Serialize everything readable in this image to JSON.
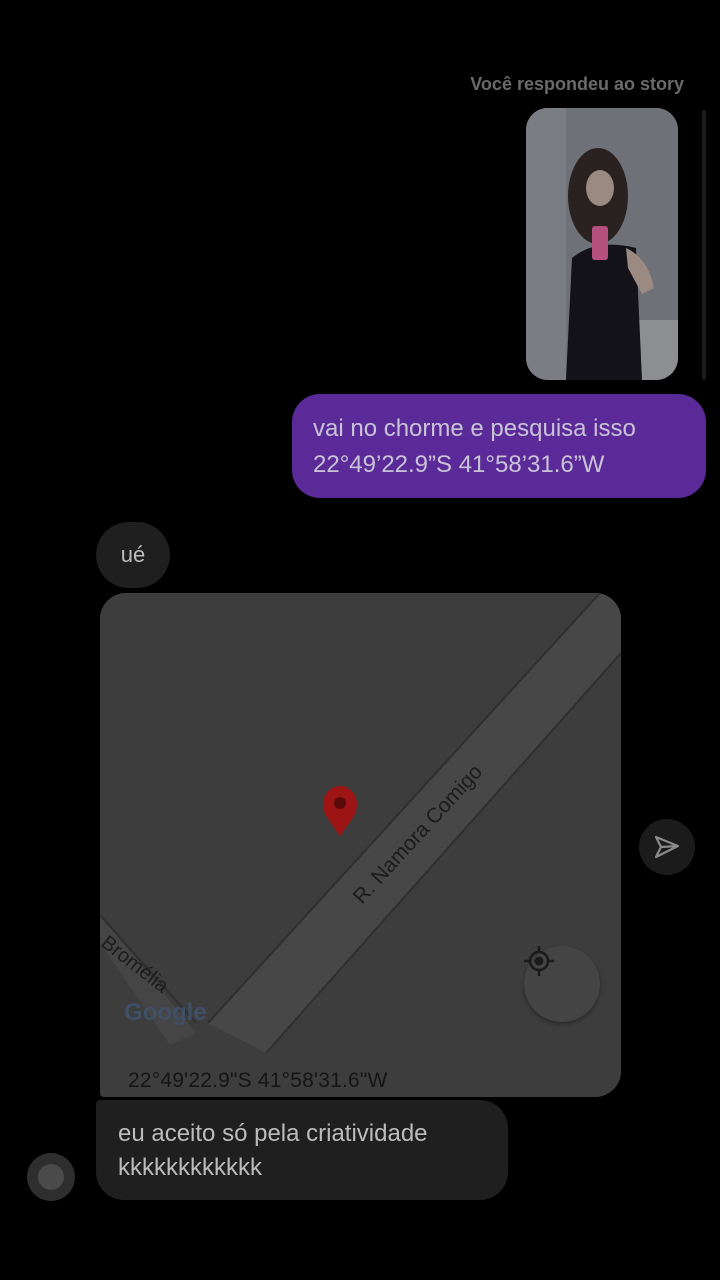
{
  "conversation": {
    "story_reply_label": "Você respondeu ao story",
    "messages": {
      "outgoing_line1": "vai no chorme e pesquisa isso",
      "outgoing_line2": "22°49’22.9”S 41°58’31.6”W",
      "incoming_short": "ué",
      "last_line1": "eu aceito só pela criatividade",
      "last_line2": "kkkkkkkkkkkk"
    },
    "map": {
      "street_main": "R. Namora Comigo",
      "street_side": "Bromélia",
      "logo_text": "Google",
      "coordinates": "22°49'22.9\"S 41°58'31.6\"W"
    }
  },
  "colors": {
    "background": "#000000",
    "outgoing_bubble": "#5b2a99",
    "incoming_bubble": "#1f1f1f",
    "map_pin": "#9c1414"
  },
  "icons": {
    "share": "send-icon",
    "locate": "my-location-icon",
    "pin": "map-pin-icon"
  }
}
